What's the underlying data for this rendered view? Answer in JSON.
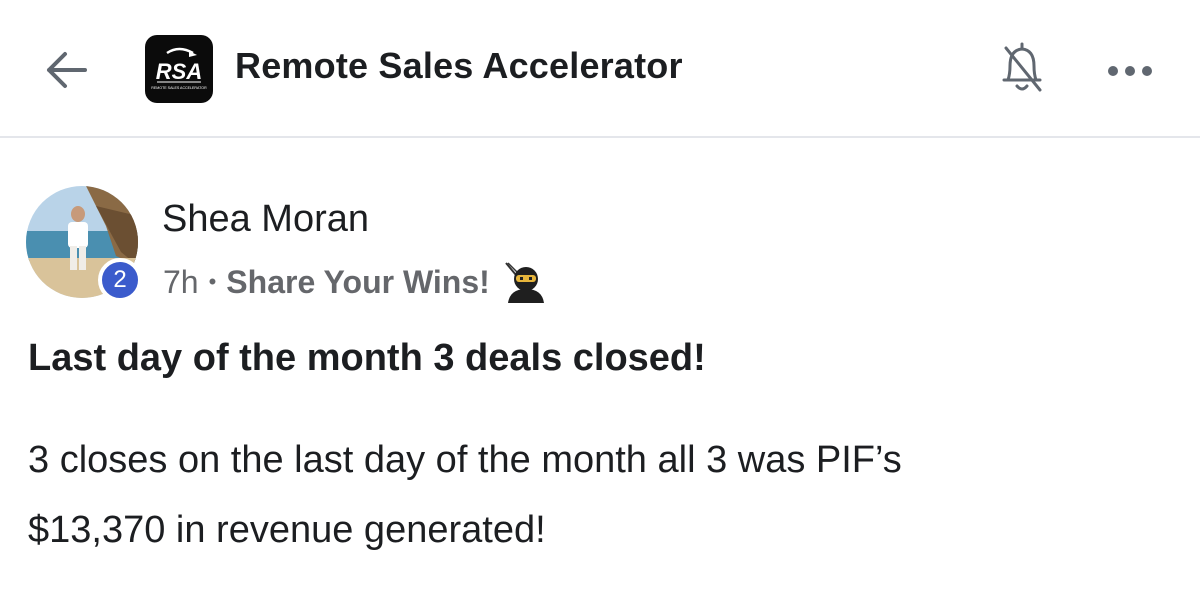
{
  "header": {
    "group_name": "Remote Sales Accelerator",
    "logo_text": "RSA",
    "logo_subtext": "REMOTE SALES ACCELERATOR",
    "back_icon": "arrow-left-icon",
    "notifications_icon": "bell-off-icon",
    "more_icon": "more-horizontal-icon"
  },
  "post": {
    "author_name": "Shea Moran",
    "author_level": "2",
    "time": "7h",
    "separator": "•",
    "category": "Share Your Wins!",
    "category_icon": "ninja-emoji-icon",
    "title": "Last day of the month 3 deals closed!",
    "body_lines": [
      "3 closes on the last day of the month all 3 was PIF’s",
      "$13,370 in revenue generated!"
    ]
  },
  "colors": {
    "text_primary": "#1c1e21",
    "text_secondary": "#65676b",
    "level_badge": "#3b5bcc",
    "divider": "#e4e6eb"
  }
}
